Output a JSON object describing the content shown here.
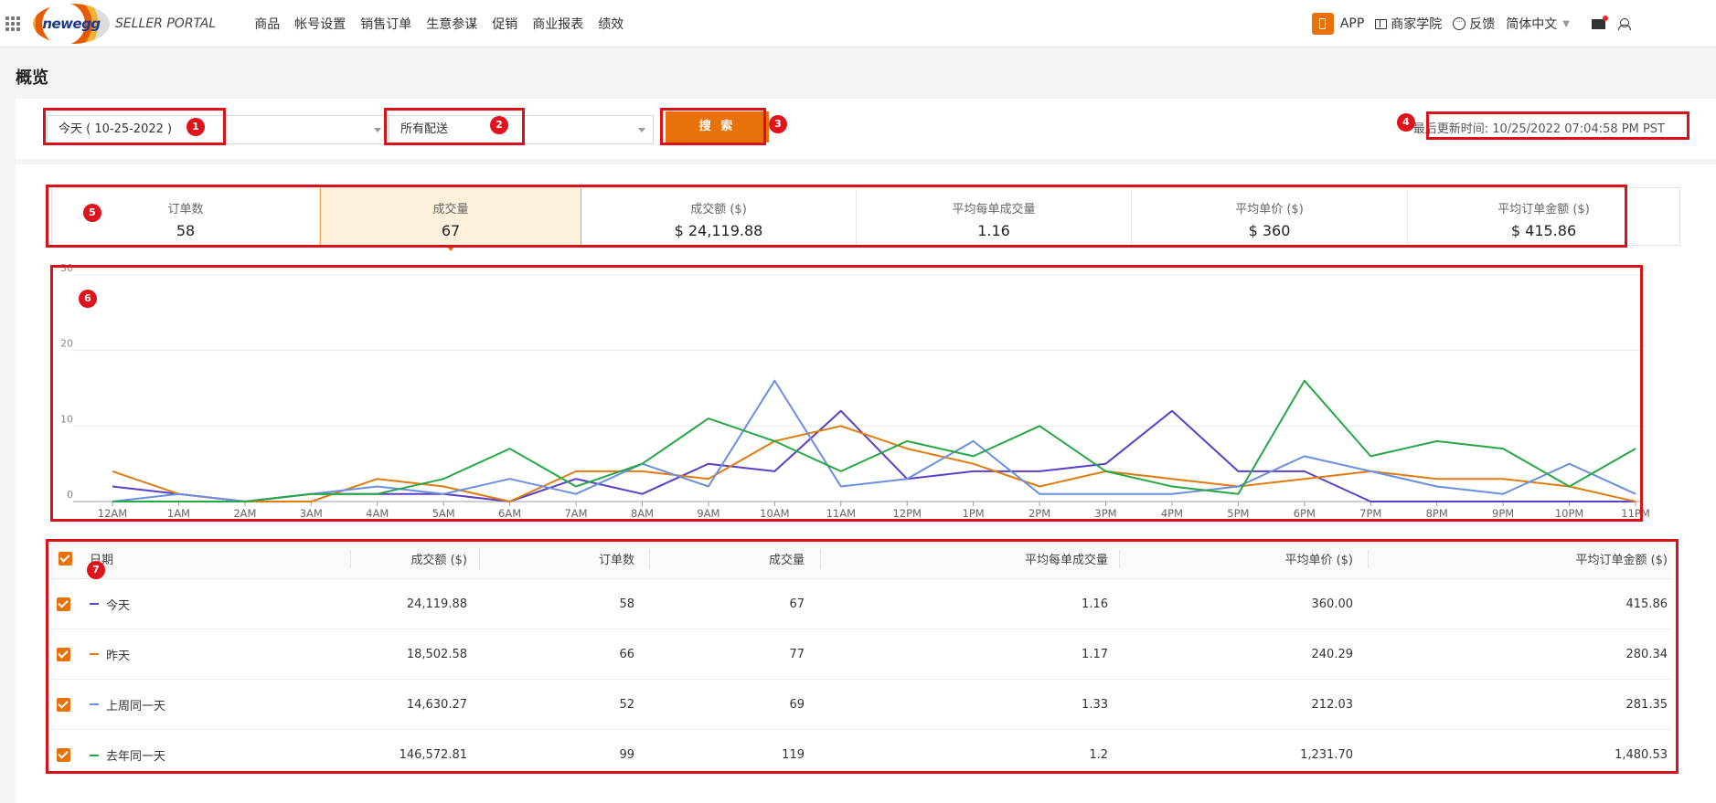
{
  "brand": {
    "logo_text": "newegg",
    "portal_text": "SELLER PORTAL"
  },
  "nav": {
    "menu": [
      "商品",
      "帐号设置",
      "销售订单",
      "生意参谋",
      "促销",
      "商业报表",
      "绩效"
    ]
  },
  "top_right": {
    "app": "APP",
    "academy": "商家学院",
    "feedback": "反馈",
    "language": "简体中文"
  },
  "page": {
    "title": "概览"
  },
  "filters": {
    "date_select": "今天 ( 10-25-2022 )",
    "shipping_select": "所有配送",
    "search_label": "搜 索",
    "last_update": "最后更新时间: 10/25/2022 07:04:58 PM PST"
  },
  "badges": [
    "1",
    "2",
    "3",
    "4",
    "5",
    "6",
    "7"
  ],
  "kpis": [
    {
      "label": "订单数",
      "value": "58"
    },
    {
      "label": "成交量",
      "value": "67"
    },
    {
      "label": "成交额 ($)",
      "value": "$ 24,119.88"
    },
    {
      "label": "平均每单成交量",
      "value": "1.16"
    },
    {
      "label": "平均单价 ($)",
      "value": "$ 360"
    },
    {
      "label": "平均订单金额 ($)",
      "value": "$ 415.86"
    }
  ],
  "chart_data": {
    "type": "line",
    "x": [
      "12AM",
      "1AM",
      "2AM",
      "3AM",
      "4AM",
      "5AM",
      "6AM",
      "7AM",
      "8AM",
      "9AM",
      "10AM",
      "11AM",
      "12PM",
      "1PM",
      "2PM",
      "3PM",
      "4PM",
      "5PM",
      "6PM",
      "7PM",
      "8PM",
      "9PM",
      "10PM",
      "11PM"
    ],
    "ylim": [
      0,
      30
    ],
    "yticks": [
      0,
      10,
      20,
      30
    ],
    "grid": true,
    "series": [
      {
        "name": "今天",
        "color": "#5b3fc4",
        "values": [
          2,
          1,
          0,
          1,
          1,
          1,
          0,
          3,
          1,
          5,
          4,
          12,
          3,
          4,
          4,
          5,
          12,
          4,
          4,
          0,
          0,
          0,
          0,
          0
        ]
      },
      {
        "name": "昨天",
        "color": "#e07b10",
        "values": [
          4,
          1,
          0,
          0,
          3,
          2,
          0,
          4,
          4,
          3,
          8,
          10,
          7,
          5,
          2,
          4,
          3,
          2,
          3,
          4,
          3,
          3,
          2,
          0
        ]
      },
      {
        "name": "上周同一天",
        "color": "#6a8fe0",
        "values": [
          0,
          1,
          0,
          1,
          2,
          1,
          3,
          1,
          5,
          2,
          16,
          2,
          3,
          8,
          1,
          1,
          1,
          2,
          6,
          4,
          2,
          1,
          5,
          1
        ]
      },
      {
        "name": "去年同一天",
        "color": "#27a745",
        "values": [
          0,
          0,
          0,
          1,
          1,
          3,
          7,
          2,
          5,
          11,
          8,
          4,
          8,
          6,
          10,
          4,
          2,
          1,
          16,
          6,
          8,
          7,
          2,
          7
        ]
      }
    ]
  },
  "table": {
    "headers": [
      "日期",
      "成交额 ($)",
      "订单数",
      "成交量",
      "平均每单成交量",
      "平均单价 ($)",
      "平均订单金额 ($)"
    ],
    "rows": [
      {
        "name": "今天",
        "color": "#5b3fc4",
        "cells": [
          "24,119.88",
          "58",
          "67",
          "1.16",
          "360.00",
          "415.86"
        ]
      },
      {
        "name": "昨天",
        "color": "#e07b10",
        "cells": [
          "18,502.58",
          "66",
          "77",
          "1.17",
          "240.29",
          "280.34"
        ]
      },
      {
        "name": "上周同一天",
        "color": "#6a8fe0",
        "cells": [
          "14,630.27",
          "52",
          "69",
          "1.33",
          "212.03",
          "281.35"
        ]
      },
      {
        "name": "去年同一天",
        "color": "#27a745",
        "cells": [
          "146,572.81",
          "99",
          "119",
          "1.2",
          "1,231.70",
          "1,480.53"
        ]
      }
    ]
  }
}
